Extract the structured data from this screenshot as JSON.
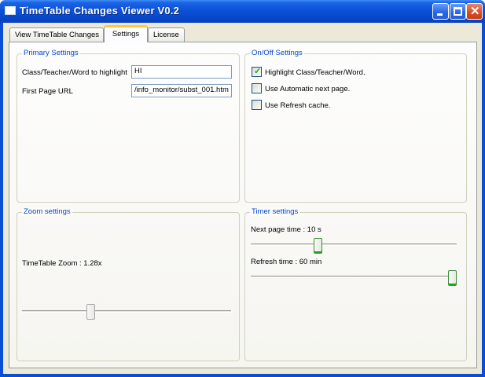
{
  "window": {
    "title": "TimeTable Changes Viewer V0.2"
  },
  "tabs": [
    {
      "label": "View TimeTable Changes"
    },
    {
      "label": "Settings"
    },
    {
      "label": "License"
    }
  ],
  "primary": {
    "title": "Primary Settings",
    "highlight_label": "Class/Teacher/Word to highlight",
    "highlight_value": "HI",
    "url_label": "First Page URL",
    "url_value": "/info_monitor/subst_001.htm"
  },
  "onoff": {
    "title": "On/Off Settings",
    "items": [
      {
        "label": "Highlight Class/Teacher/Word.",
        "checked": true
      },
      {
        "label": "Use Automatic next page.",
        "checked": false
      },
      {
        "label": "Use Refresh cache.",
        "checked": false
      }
    ]
  },
  "zoom": {
    "title": "Zoom settings",
    "label": "TimeTable Zoom : 1.28x",
    "slider_fraction": 0.32
  },
  "timer": {
    "title": "Timer settings",
    "next_label": "Next page time : 10 s",
    "next_fraction": 0.32,
    "refresh_label": "Refresh time : 60 min",
    "refresh_fraction": 1.0
  }
}
